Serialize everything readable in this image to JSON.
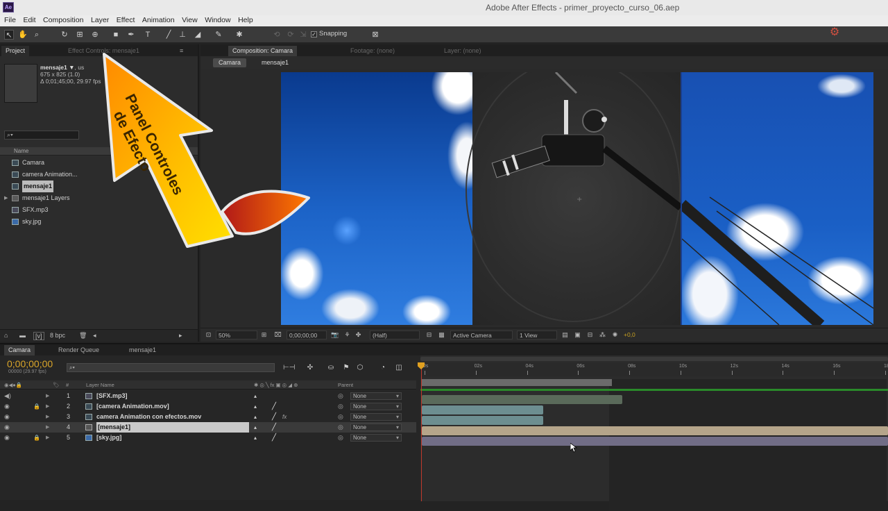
{
  "app": {
    "icon_text": "Ae",
    "title": "Adobe After Effects - primer_proyecto_curso_06.aep"
  },
  "menu": [
    "File",
    "Edit",
    "Composition",
    "Layer",
    "Effect",
    "Animation",
    "View",
    "Window",
    "Help"
  ],
  "toolbar": {
    "snapping_label": "Snapping"
  },
  "project_panel": {
    "tabs": [
      "Project",
      "Effect Controls: mensaje1"
    ],
    "selected_name": "mensaje1 ▼",
    "selected_suffix": ", us",
    "info_line1": "675 x 825 (1.0)",
    "info_line2": "Δ 0;01;45;00, 29.97 fps",
    "search_placeholder": "⌕▾",
    "header_name": "Name",
    "items": [
      {
        "label": "Camara",
        "icon": "composition-icon"
      },
      {
        "label": "camera Animation...",
        "icon": "footage-icon"
      },
      {
        "label": "mensaje1",
        "icon": "composition-icon"
      },
      {
        "label": "mensaje1 Layers",
        "icon": "folder-icon"
      },
      {
        "label": "SFX.mp3",
        "icon": "audio-icon"
      },
      {
        "label": "sky.jpg",
        "icon": "image-icon"
      }
    ],
    "footer_bpc": "8 bpc"
  },
  "annotation": {
    "line1": "Panel Controles",
    "line2": "de Efecto"
  },
  "comp_panel": {
    "tabs": [
      "Composition: Camara",
      "Footage: (none)",
      "Layer: (none)"
    ],
    "breadcrumbs": [
      "Camara",
      "mensaje1"
    ],
    "footer": {
      "zoom": "50%",
      "timecode": "0;00;00;00",
      "resolution": "(Half)",
      "camera": "Active Camera",
      "views": "1 View",
      "exposure": "+0,0"
    }
  },
  "timeline": {
    "tabs": [
      "Camara",
      "Render Queue",
      "mensaje1"
    ],
    "timecode": "0;00;00;00",
    "frames": "00000 (29.97 fps)",
    "search_placeholder": "⌕▾",
    "header": {
      "layer_name": "Layer Name",
      "parent": "Parent"
    },
    "layers": [
      {
        "num": "1",
        "name": "[SFX.mp3]",
        "parent": "None",
        "bar_color": "#5a6a5a",
        "bar_fraction": 0.43
      },
      {
        "num": "2",
        "name": "[camera Animation.mov]",
        "parent": "None",
        "bar_color": "#6d8e90",
        "bar_fraction": 0.26
      },
      {
        "num": "3",
        "name": "camera Animation con efectos.mov",
        "parent": "None",
        "bar_color": "#6d8e90",
        "bar_fraction": 0.26
      },
      {
        "num": "4",
        "name": "[mensaje1]",
        "parent": "None",
        "bar_color": "#b5a58a",
        "bar_fraction": 1.0
      },
      {
        "num": "5",
        "name": "[sky.jpg]",
        "parent": "None",
        "bar_color": "#716d86",
        "bar_fraction": 1.0
      }
    ],
    "ruler_labels": [
      "0s",
      "02s",
      "04s",
      "06s",
      "08s",
      "10s",
      "12s",
      "14s",
      "16s",
      "18s"
    ]
  }
}
